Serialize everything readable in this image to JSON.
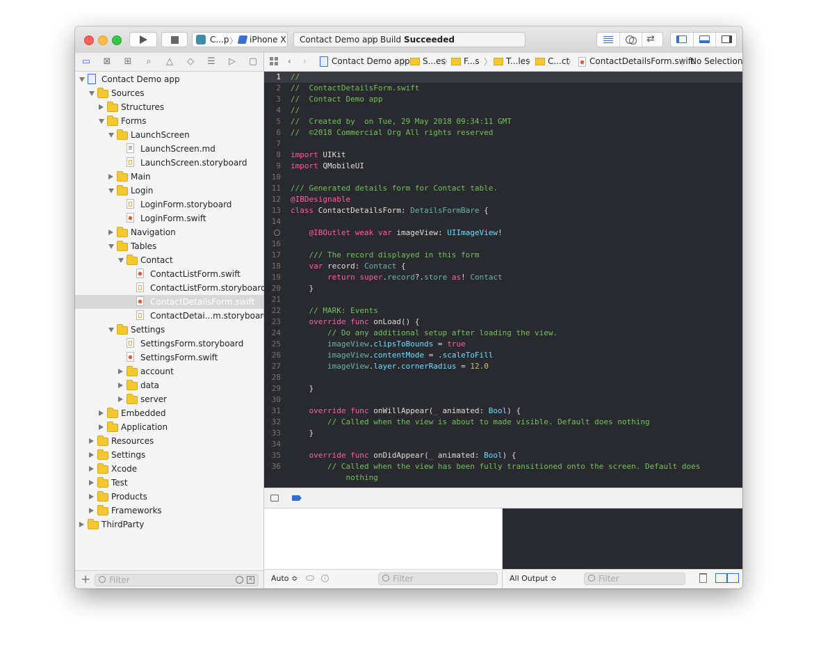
{
  "toolbar": {
    "scheme": {
      "app_short": "C...p",
      "separator": "〉",
      "device": "iPhone X"
    },
    "activity": {
      "project": "Contact Demo app",
      "separator": "|",
      "build_prefix": "Build",
      "build_status": "Succeeded"
    }
  },
  "navigator": {
    "tabs": [
      {
        "icon": "folder-icon",
        "glyph": "▭"
      },
      {
        "icon": "source-control-icon",
        "glyph": "⊠"
      },
      {
        "icon": "symbol-icon",
        "glyph": "⊞"
      },
      {
        "icon": "search-icon",
        "glyph": "⌕"
      },
      {
        "icon": "warning-icon",
        "glyph": "△"
      },
      {
        "icon": "test-icon",
        "glyph": "◇"
      },
      {
        "icon": "debug-icon",
        "glyph": "☰"
      },
      {
        "icon": "breakpoint-icon",
        "glyph": "▷"
      },
      {
        "icon": "report-icon",
        "glyph": "▢"
      }
    ],
    "tree": [
      {
        "label": "Contact Demo app",
        "type": "project",
        "depth": 0,
        "state": "open"
      },
      {
        "label": "Sources",
        "type": "folder",
        "depth": 1,
        "state": "open"
      },
      {
        "label": "Structures",
        "type": "folder",
        "depth": 2,
        "state": "closed"
      },
      {
        "label": "Forms",
        "type": "folder",
        "depth": 2,
        "state": "open"
      },
      {
        "label": "LaunchScreen",
        "type": "folder",
        "depth": 3,
        "state": "open"
      },
      {
        "label": "LaunchScreen.md",
        "type": "md",
        "depth": 4,
        "state": "none"
      },
      {
        "label": "LaunchScreen.storyboard",
        "type": "story",
        "depth": 4,
        "state": "none"
      },
      {
        "label": "Main",
        "type": "folder",
        "depth": 3,
        "state": "closed"
      },
      {
        "label": "Login",
        "type": "folder",
        "depth": 3,
        "state": "open"
      },
      {
        "label": "LoginForm.storyboard",
        "type": "story",
        "depth": 4,
        "state": "none"
      },
      {
        "label": "LoginForm.swift",
        "type": "swift",
        "depth": 4,
        "state": "none"
      },
      {
        "label": "Navigation",
        "type": "folder",
        "depth": 3,
        "state": "closed"
      },
      {
        "label": "Tables",
        "type": "folder",
        "depth": 3,
        "state": "open"
      },
      {
        "label": "Contact",
        "type": "folder",
        "depth": 4,
        "state": "open"
      },
      {
        "label": "ContactListForm.swift",
        "type": "swift",
        "depth": 5,
        "state": "none"
      },
      {
        "label": "ContactListForm.storyboard",
        "type": "story",
        "depth": 5,
        "state": "none"
      },
      {
        "label": "ContactDetailsForm.swift",
        "type": "swift",
        "depth": 5,
        "state": "none",
        "selected": true
      },
      {
        "label": "ContactDetai...m.storyboard",
        "type": "story",
        "depth": 5,
        "state": "none"
      },
      {
        "label": "Settings",
        "type": "folder",
        "depth": 3,
        "state": "open"
      },
      {
        "label": "SettingsForm.storyboard",
        "type": "story",
        "depth": 4,
        "state": "none"
      },
      {
        "label": "SettingsForm.swift",
        "type": "swift",
        "depth": 4,
        "state": "none"
      },
      {
        "label": "account",
        "type": "folder",
        "depth": 4,
        "state": "closed"
      },
      {
        "label": "data",
        "type": "folder",
        "depth": 4,
        "state": "closed"
      },
      {
        "label": "server",
        "type": "folder",
        "depth": 4,
        "state": "closed"
      },
      {
        "label": "Embedded",
        "type": "folder",
        "depth": 2,
        "state": "closed"
      },
      {
        "label": "Application",
        "type": "folder",
        "depth": 2,
        "state": "closed"
      },
      {
        "label": "Resources",
        "type": "folder",
        "depth": 1,
        "state": "closed"
      },
      {
        "label": "Settings",
        "type": "folder",
        "depth": 1,
        "state": "closed"
      },
      {
        "label": "Xcode",
        "type": "folder",
        "depth": 1,
        "state": "closed"
      },
      {
        "label": "Test",
        "type": "folder",
        "depth": 1,
        "state": "closed"
      },
      {
        "label": "Products",
        "type": "folder",
        "depth": 1,
        "state": "closed"
      },
      {
        "label": "Frameworks",
        "type": "folder",
        "depth": 1,
        "state": "closed"
      },
      {
        "label": "ThirdParty",
        "type": "folder",
        "depth": 0,
        "state": "closed"
      }
    ],
    "filter_placeholder": "Filter"
  },
  "jumpbar": {
    "project": "Contact Demo app",
    "crumb1": "S...es",
    "crumb2": "F...s",
    "crumb3": "T...les",
    "crumb4": "C...ct",
    "file": "ContactDetailsForm.swift",
    "selection": "No Selection"
  },
  "code": [
    {
      "n": "1",
      "current": true,
      "segs": [
        [
          "c",
          "//"
        ]
      ]
    },
    {
      "n": "2",
      "segs": [
        [
          "c",
          "//  ContactDetailsForm.swift"
        ]
      ]
    },
    {
      "n": "3",
      "segs": [
        [
          "c",
          "//  Contact Demo app"
        ]
      ]
    },
    {
      "n": "4",
      "segs": [
        [
          "c",
          "//"
        ]
      ]
    },
    {
      "n": "5",
      "segs": [
        [
          "c",
          "//  Created by  on Tue, 29 May 2018 09:34:11 GMT"
        ]
      ]
    },
    {
      "n": "6",
      "segs": [
        [
          "c",
          "//  ©2018 Commercial Org All rights reserved"
        ]
      ]
    },
    {
      "n": "7",
      "segs": []
    },
    {
      "n": "8",
      "segs": [
        [
          "k",
          "import"
        ],
        [
          "p",
          " UIKit"
        ]
      ]
    },
    {
      "n": "9",
      "segs": [
        [
          "k",
          "import"
        ],
        [
          "p",
          " QMobileUI"
        ]
      ]
    },
    {
      "n": "10",
      "segs": []
    },
    {
      "n": "11",
      "segs": [
        [
          "c",
          "/// Generated details form for Contact table."
        ]
      ]
    },
    {
      "n": "12",
      "segs": [
        [
          "k",
          "@IBDesignable"
        ]
      ]
    },
    {
      "n": "13",
      "segs": [
        [
          "k",
          "class"
        ],
        [
          "p",
          " ContactDetailsForm: "
        ],
        [
          "f",
          "DetailsFormBare"
        ],
        [
          "p",
          " {"
        ]
      ]
    },
    {
      "n": "14",
      "segs": []
    },
    {
      "n": "",
      "bp": true,
      "segs": [
        [
          "p",
          "    "
        ],
        [
          "k",
          "@IBOutlet weak var"
        ],
        [
          "p",
          " imageView: "
        ],
        [
          "t",
          "UIImageView"
        ],
        [
          "p",
          "!"
        ]
      ]
    },
    {
      "n": "16",
      "segs": []
    },
    {
      "n": "17",
      "segs": [
        [
          "p",
          "    "
        ],
        [
          "c",
          "/// The record displayed in this form"
        ]
      ]
    },
    {
      "n": "18",
      "segs": [
        [
          "p",
          "    "
        ],
        [
          "k",
          "var"
        ],
        [
          "p",
          " record: "
        ],
        [
          "f",
          "Contact"
        ],
        [
          "p",
          " {"
        ]
      ]
    },
    {
      "n": "19",
      "segs": [
        [
          "p",
          "        "
        ],
        [
          "k",
          "return super"
        ],
        [
          "p",
          "."
        ],
        [
          "f",
          "record"
        ],
        [
          "p",
          "?."
        ],
        [
          "f",
          "store"
        ],
        [
          "p",
          " "
        ],
        [
          "k",
          "as"
        ],
        [
          "p",
          "! "
        ],
        [
          "f",
          "Contact"
        ]
      ]
    },
    {
      "n": "20",
      "segs": [
        [
          "p",
          "    }"
        ]
      ]
    },
    {
      "n": "21",
      "segs": []
    },
    {
      "n": "22",
      "segs": [
        [
          "p",
          "    "
        ],
        [
          "c",
          "// MARK: Events"
        ]
      ]
    },
    {
      "n": "23",
      "segs": [
        [
          "p",
          "    "
        ],
        [
          "k",
          "override func"
        ],
        [
          "p",
          " onLoad() {"
        ]
      ]
    },
    {
      "n": "24",
      "segs": [
        [
          "p",
          "        "
        ],
        [
          "c",
          "// Do any additional setup after loading the view."
        ]
      ]
    },
    {
      "n": "25",
      "segs": [
        [
          "p",
          "        "
        ],
        [
          "f",
          "imageView"
        ],
        [
          "p",
          "."
        ],
        [
          "t",
          "clipsToBounds"
        ],
        [
          "p",
          " = "
        ],
        [
          "k",
          "true"
        ]
      ]
    },
    {
      "n": "26",
      "segs": [
        [
          "p",
          "        "
        ],
        [
          "f",
          "imageView"
        ],
        [
          "p",
          "."
        ],
        [
          "t",
          "contentMode"
        ],
        [
          "p",
          " = ."
        ],
        [
          "t",
          "scaleToFill"
        ]
      ]
    },
    {
      "n": "27",
      "segs": [
        [
          "p",
          "        "
        ],
        [
          "f",
          "imageView"
        ],
        [
          "p",
          "."
        ],
        [
          "t",
          "layer"
        ],
        [
          "p",
          "."
        ],
        [
          "t",
          "cornerRadius"
        ],
        [
          "p",
          " = "
        ],
        [
          "n",
          "12.0"
        ]
      ]
    },
    {
      "n": "28",
      "segs": []
    },
    {
      "n": "29",
      "segs": [
        [
          "p",
          "    }"
        ]
      ]
    },
    {
      "n": "30",
      "segs": []
    },
    {
      "n": "31",
      "segs": [
        [
          "p",
          "    "
        ],
        [
          "k",
          "override func"
        ],
        [
          "p",
          " onWillAppear("
        ],
        [
          "k",
          "_"
        ],
        [
          "p",
          " animated: "
        ],
        [
          "t",
          "Bool"
        ],
        [
          "p",
          ") {"
        ]
      ]
    },
    {
      "n": "32",
      "segs": [
        [
          "p",
          "        "
        ],
        [
          "c",
          "// Called when the view is about to made visible. Default does nothing"
        ]
      ]
    },
    {
      "n": "33",
      "segs": [
        [
          "p",
          "    }"
        ]
      ]
    },
    {
      "n": "34",
      "segs": []
    },
    {
      "n": "35",
      "segs": [
        [
          "p",
          "    "
        ],
        [
          "k",
          "override func"
        ],
        [
          "p",
          " onDidAppear("
        ],
        [
          "k",
          "_"
        ],
        [
          "p",
          " animated: "
        ],
        [
          "t",
          "Bool"
        ],
        [
          "p",
          ") {"
        ]
      ]
    },
    {
      "n": "36",
      "segs": [
        [
          "p",
          "        "
        ],
        [
          "c",
          "// Called when the view has been fully transitioned onto the screen. Default does"
        ]
      ]
    },
    {
      "n": "",
      "segs": [
        [
          "p",
          "            "
        ],
        [
          "c",
          "nothing"
        ]
      ]
    }
  ],
  "debug": {
    "auto_label": "Auto ≎",
    "filter_placeholder": "Filter",
    "output_label": "All Output ≎",
    "console_filter_placeholder": "Filter"
  }
}
